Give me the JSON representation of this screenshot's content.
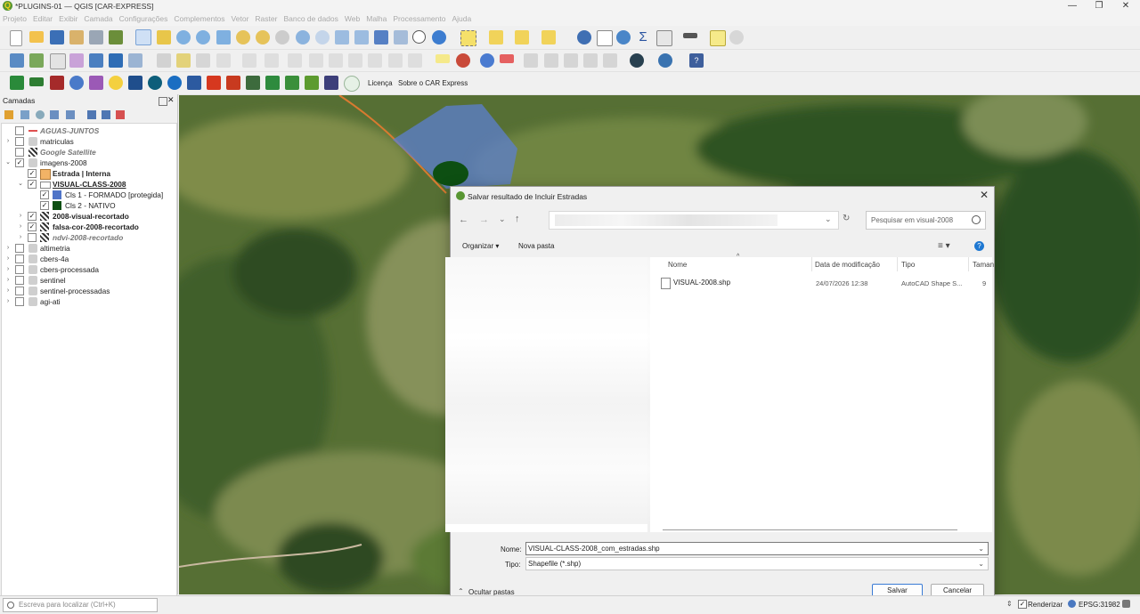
{
  "window": {
    "title": "*PLUGINS-01 — QGIS [CAR-EXPRESS]"
  },
  "menu": [
    "Projeto",
    "Editar",
    "Exibir",
    "Camada",
    "Configurações",
    "Complementos",
    "Vetor",
    "Raster",
    "Banco de dados",
    "Web",
    "Malha",
    "Processamento",
    "Ajuda"
  ],
  "plugin_toolbar": {
    "license_label": "Licença",
    "about_label": "Sobre o CAR Express"
  },
  "layers_panel": {
    "title": "Camadas",
    "layers": [
      {
        "name": "AGUAS-JUNTOS"
      },
      {
        "name": "matriculas"
      },
      {
        "name": "Google Satellite"
      },
      {
        "name": "imagens-2008"
      },
      {
        "name": "Estrada | Interna"
      },
      {
        "name": "VISUAL-CLASS-2008"
      },
      {
        "name": "Cls 1 - FORMADO [protegida]"
      },
      {
        "name": "Cls 2 - NATIVO"
      },
      {
        "name": "2008-visual-recortado"
      },
      {
        "name": "falsa-cor-2008-recortado"
      },
      {
        "name": "ndvi-2008-recortado"
      },
      {
        "name": "altimetria"
      },
      {
        "name": "cbers-4a"
      },
      {
        "name": "cbers-processada"
      },
      {
        "name": "sentinel"
      },
      {
        "name": "sentinel-processadas"
      },
      {
        "name": "agi-ati"
      }
    ]
  },
  "dialog": {
    "title": "Salvar resultado de Incluir Estradas",
    "search_placeholder": "Pesquisar em visual-2008",
    "organize_label": "Organizar ▾",
    "new_folder_label": "Nova pasta",
    "columns": {
      "name": "Nome",
      "modified": "Data de modificação",
      "type": "Tipo",
      "size": "Taman"
    },
    "files": [
      {
        "name": "VISUAL-2008.shp",
        "modified": "24/07/2026 12:38",
        "type": "AutoCAD Shape S...",
        "size": "9"
      }
    ],
    "filename_label": "Nome:",
    "filename_value": "VISUAL-CLASS-2008_com_estradas.shp",
    "type_label": "Tipo:",
    "type_value": "Shapefile (*.shp)",
    "hide_folders_label": "Ocultar pastas",
    "save_label": "Salvar",
    "cancel_label": "Cancelar"
  },
  "statusbar": {
    "locator_placeholder": "Escreva para localizar (Ctrl+K)",
    "render_label": "Renderizar",
    "crs_label": "EPSG:31982"
  },
  "colors": {
    "formado": "#4f74c8",
    "nativo": "#0d4f12",
    "estrada": "#f2b366"
  }
}
